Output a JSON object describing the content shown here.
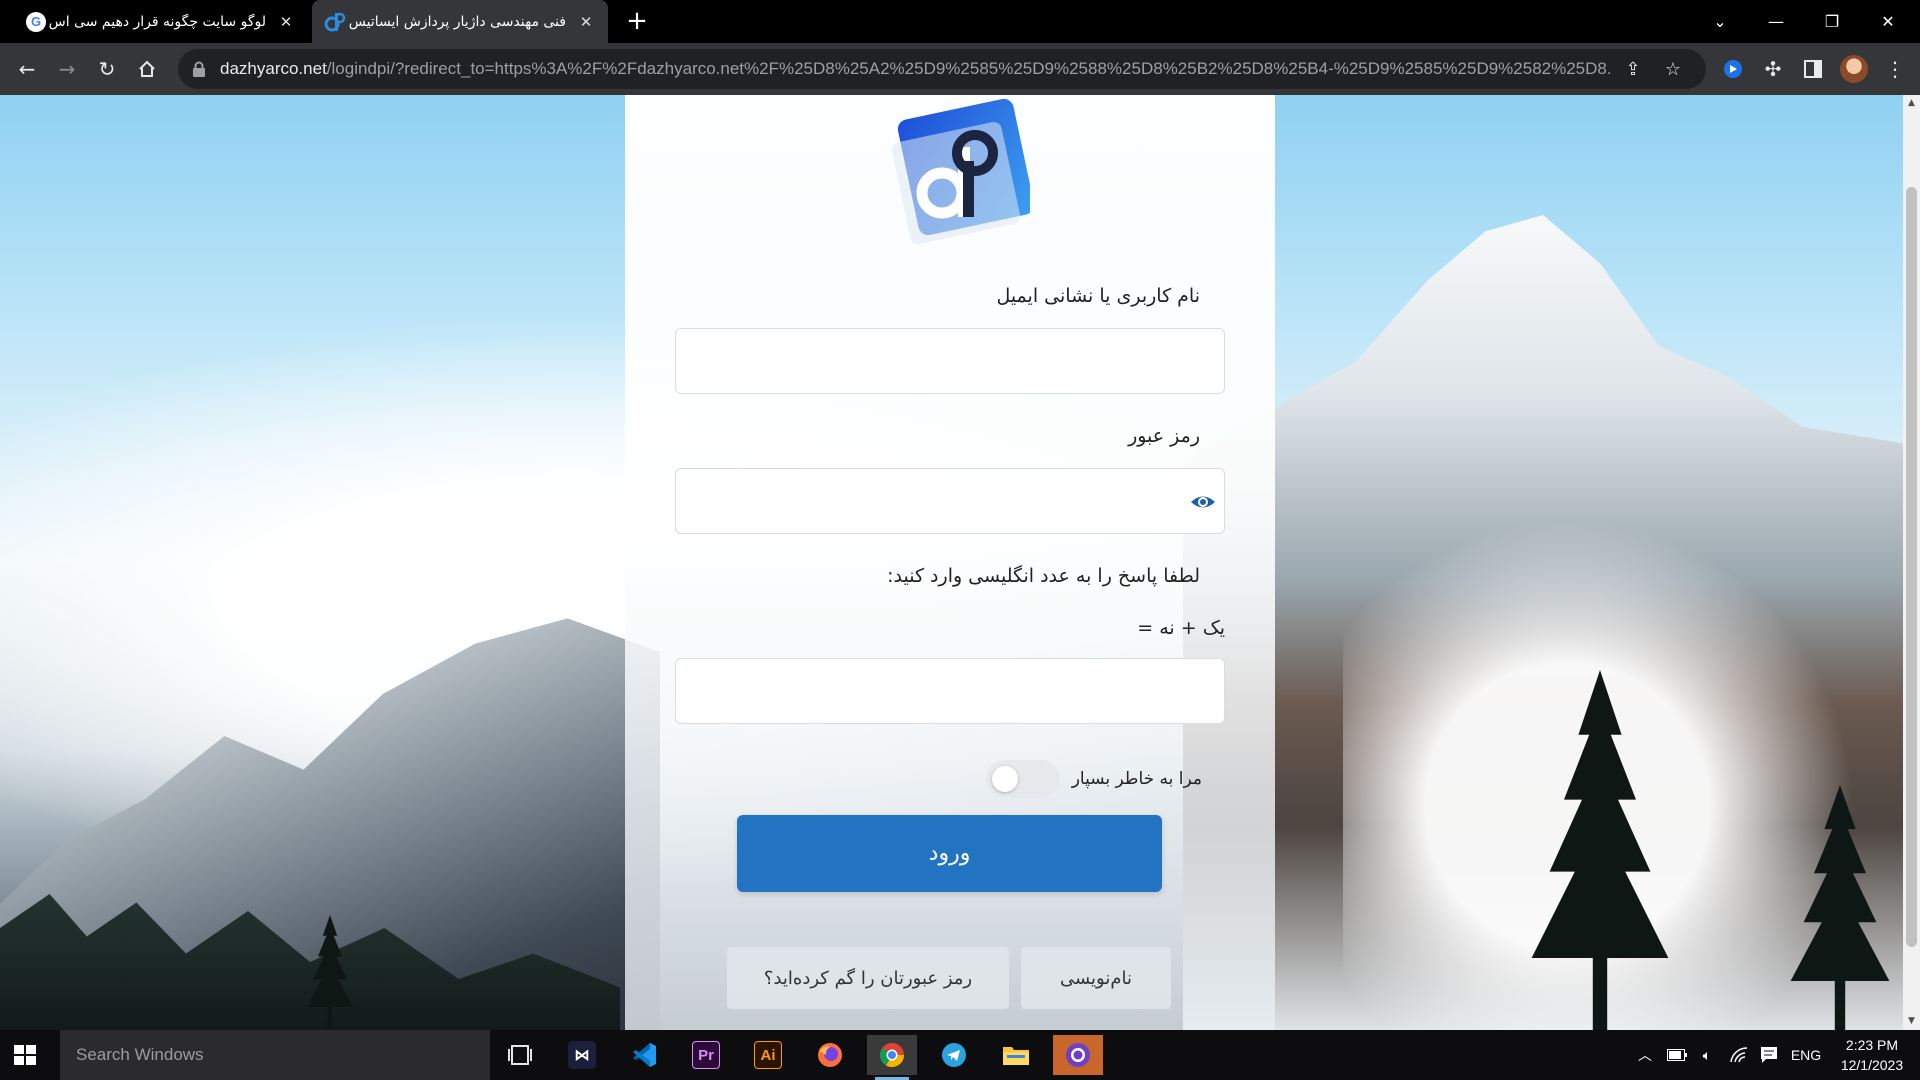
{
  "browser": {
    "tabs": [
      {
        "title": "لوگو سایت چگونه قرار دهیم سی اس",
        "active": false
      },
      {
        "title": "فنی مهندسی داژیار پردازش ایساتیس",
        "active": true
      }
    ],
    "new_tab_symbol": "+",
    "url_host": "dazhyarco.net",
    "url_path": "/logindpi/?redirect_to=https%3A%2F%2Fdazhyarco.net%2F%25D8%25A2%25D9%2585%25D9%2588%25D8%25B2%25D8%25B4-%25D9%2585%25D9%2582%25D8..."
  },
  "login": {
    "username_label": "نام کاربری یا نشانی ایمیل",
    "username_value": "",
    "password_label": "رمز عبور",
    "password_value": "",
    "captcha_prompt": "لطفا پاسخ را به عدد انگلیسی وارد کنید:",
    "captcha_question": "یک + نه =",
    "captcha_value": "",
    "remember_label": "مرا به خاطر بسپار",
    "remember_checked": false,
    "submit_label": "ورود",
    "register_label": "نام‌نویسی",
    "lost_password_label": "رمز عبورتان را گم کرده‌اید؟"
  },
  "taskbar": {
    "search_placeholder": "Search Windows",
    "apps": [
      "task-view",
      "visual-studio",
      "vscode",
      "premiere-pro",
      "illustrator",
      "firefox",
      "chrome",
      "telegram",
      "file-explorer",
      "github-desktop"
    ],
    "premiere_label": "Pr",
    "illustrator_label": "Ai",
    "language": "ENG",
    "time": "2:23 PM",
    "date": "12/1/2023"
  },
  "colors": {
    "primary_button": "#2274c3",
    "tab_bar": "#000000",
    "toolbar": "#35363a"
  }
}
